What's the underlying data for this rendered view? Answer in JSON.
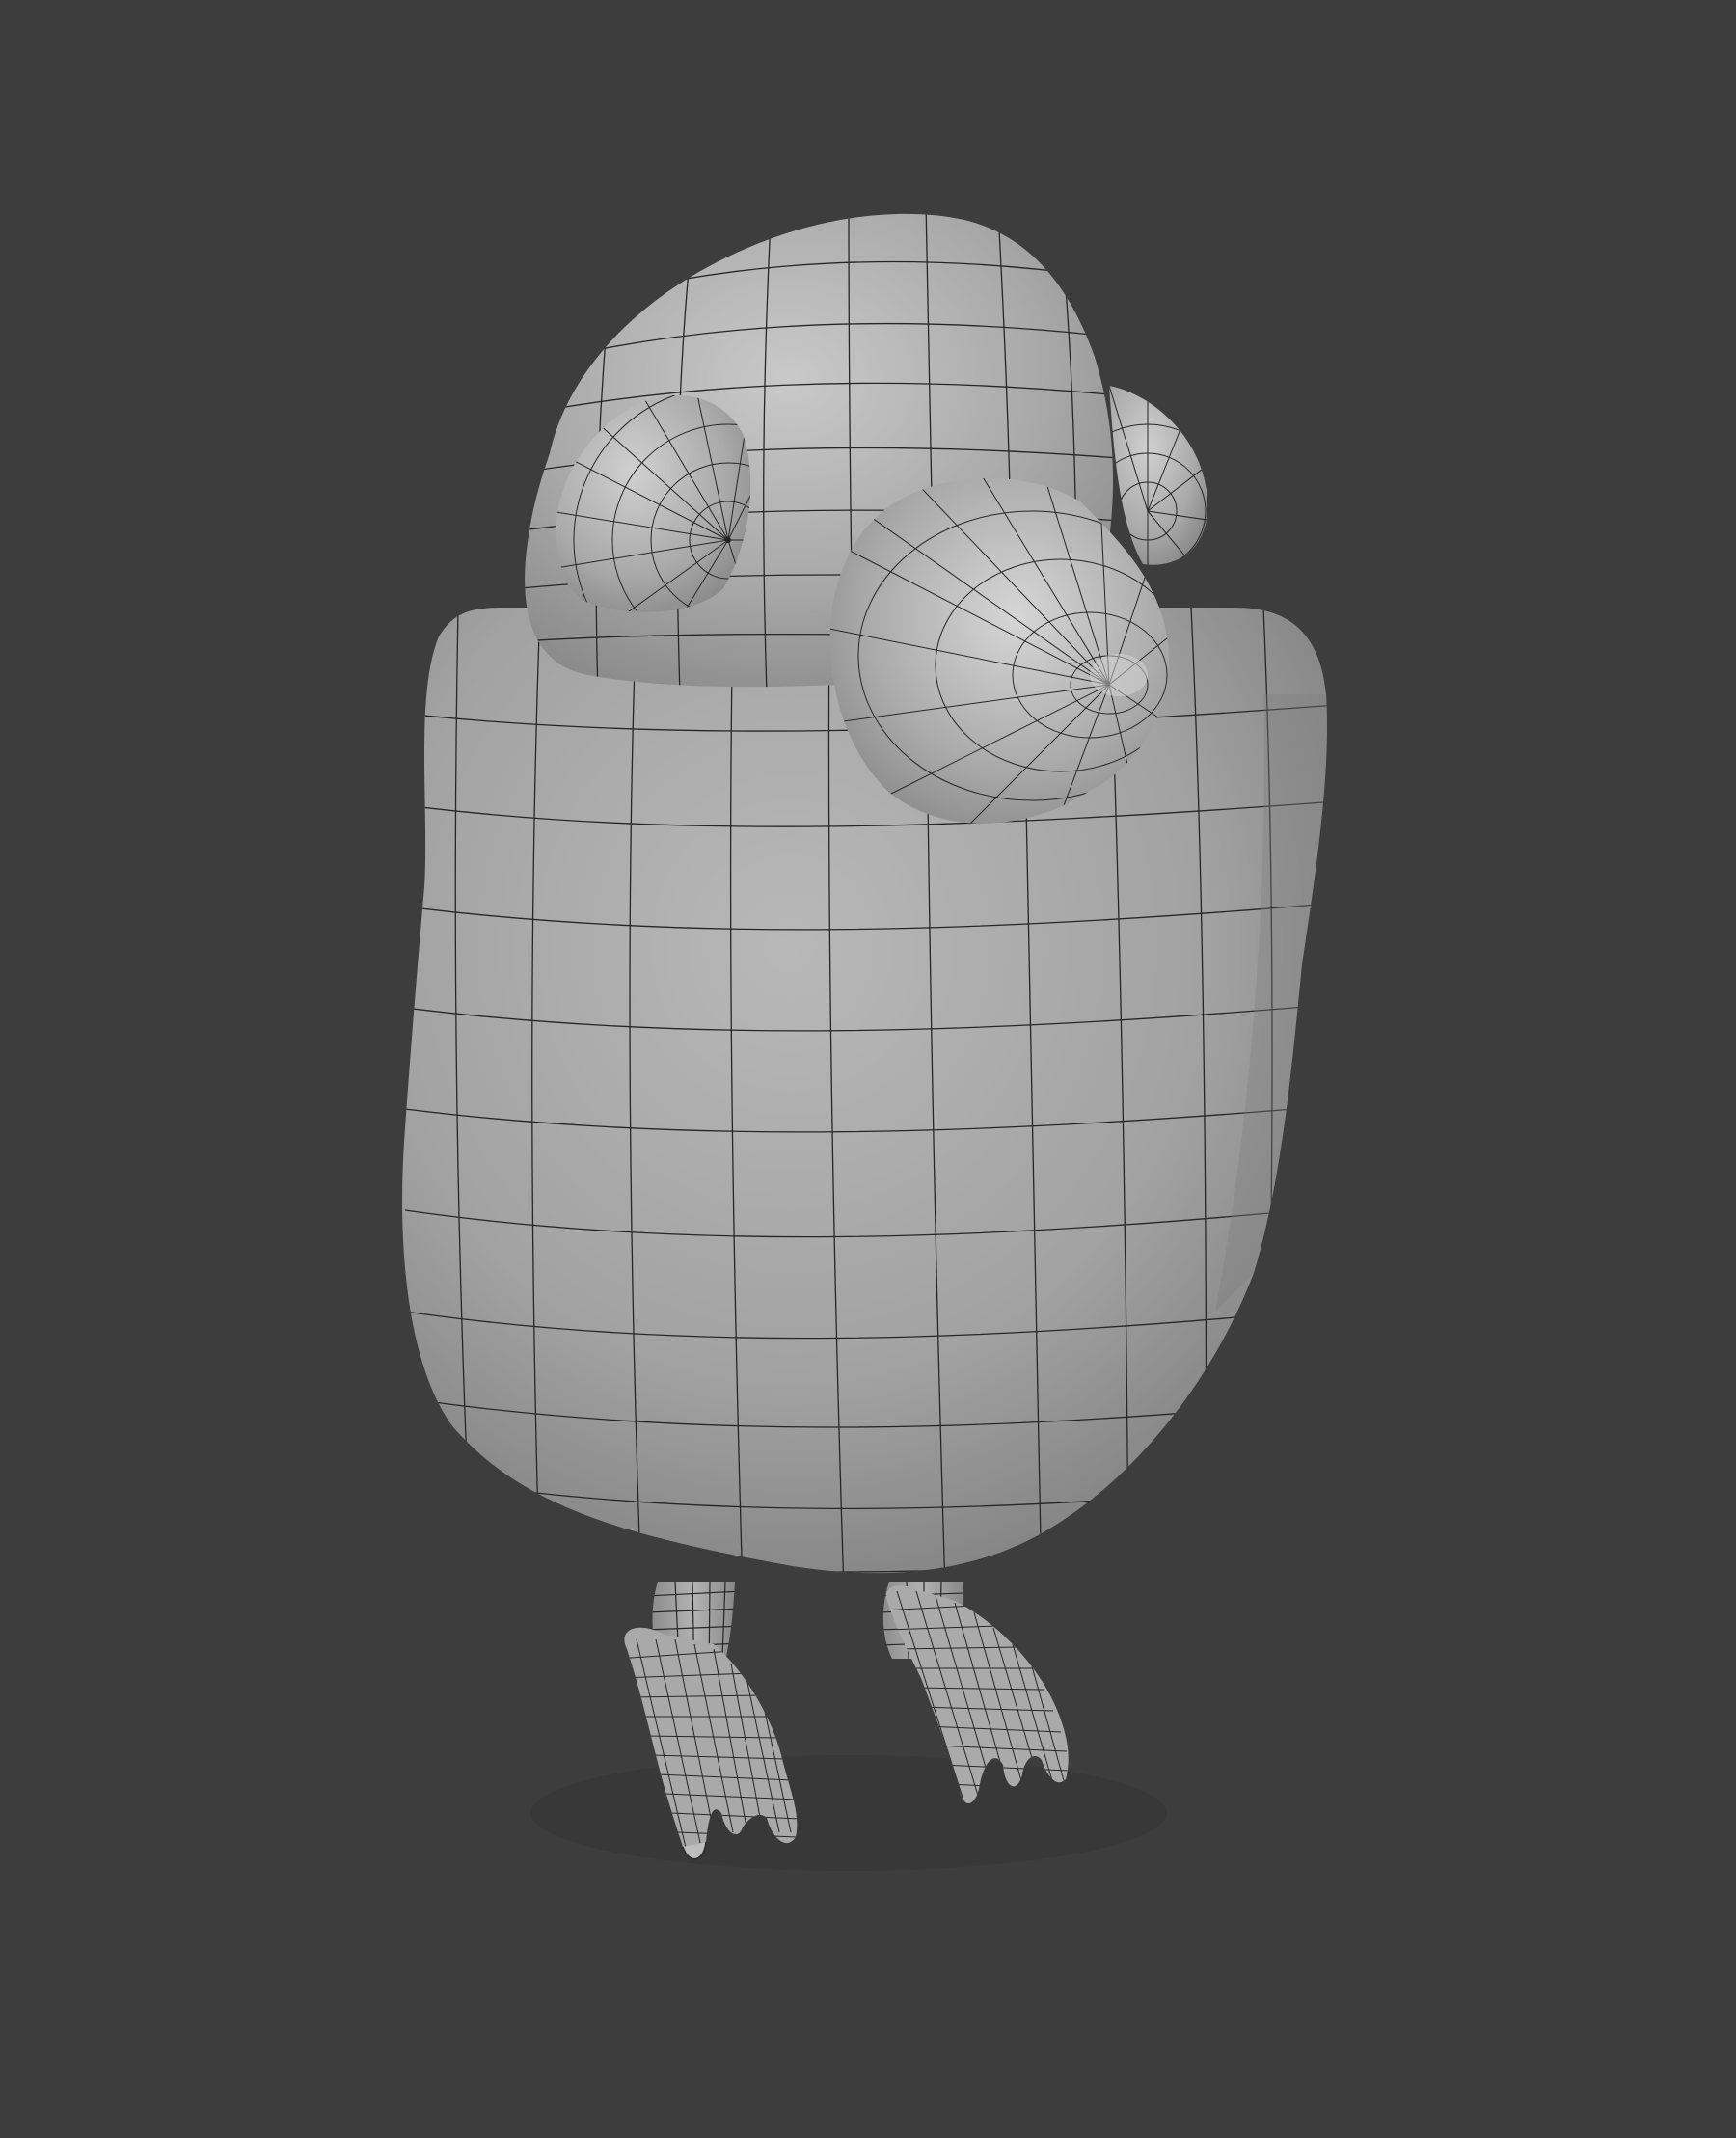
{
  "viewport": {
    "background": "#3d3d3d",
    "object": "bird-mesh",
    "shading": "solid",
    "wireframe_overlay": true
  },
  "colors": {
    "background": "#3d3d3d",
    "mesh_surface": "#a6a6a6",
    "mesh_highlight": "#d4d4d4",
    "mesh_shadow": "#7a7a7a",
    "wire": "#262626"
  }
}
